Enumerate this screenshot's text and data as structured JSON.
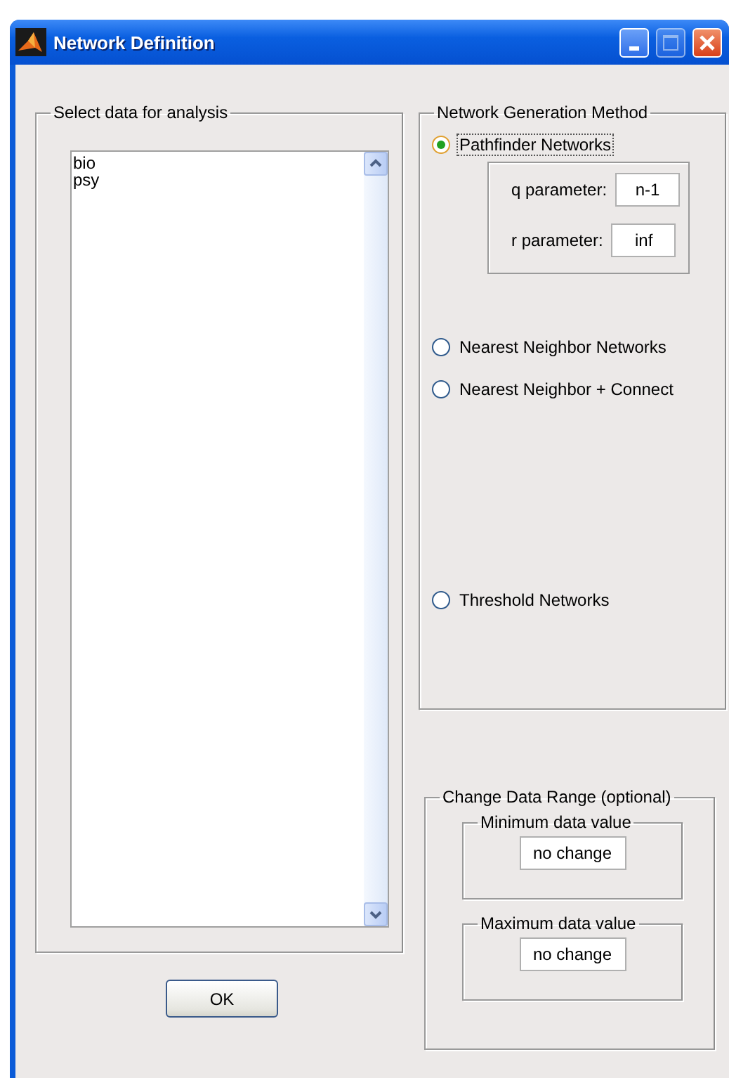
{
  "window": {
    "title": "Network Definition"
  },
  "data_panel": {
    "title": "Select data for analysis",
    "items": [
      {
        "label": "bio"
      },
      {
        "label": "psy"
      }
    ]
  },
  "ok_button": "OK",
  "method_panel": {
    "title": "Network Generation Method",
    "options": [
      {
        "label": "Pathfinder Networks",
        "selected": true
      },
      {
        "label": "Nearest Neighbor Networks",
        "selected": false
      },
      {
        "label": "Nearest Neighbor + Connect",
        "selected": false
      },
      {
        "label": "Threshold Networks",
        "selected": false
      }
    ],
    "parameters": [
      {
        "label": "q parameter:",
        "value": "n-1"
      },
      {
        "label": "r parameter:",
        "value": "inf"
      }
    ]
  },
  "range_panel": {
    "title": "Change Data Range (optional)",
    "fields": [
      {
        "title": "Minimum data value",
        "value": "no change"
      },
      {
        "title": "Maximum data value",
        "value": "no change"
      }
    ]
  }
}
